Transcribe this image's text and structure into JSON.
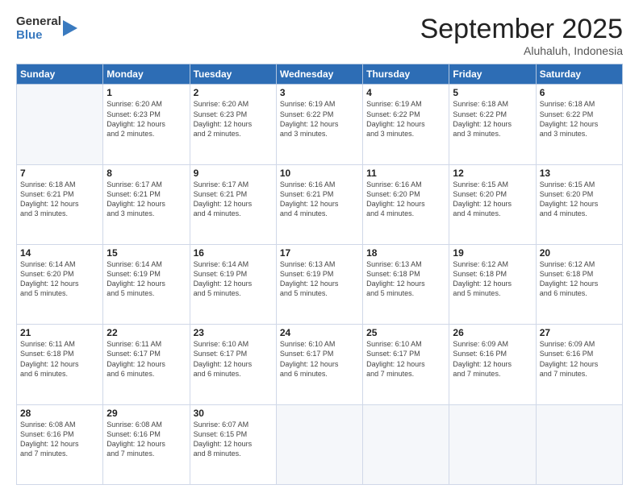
{
  "logo": {
    "general": "General",
    "blue": "Blue"
  },
  "header": {
    "month": "September 2025",
    "location": "Aluhaluh, Indonesia"
  },
  "weekdays": [
    "Sunday",
    "Monday",
    "Tuesday",
    "Wednesday",
    "Thursday",
    "Friday",
    "Saturday"
  ],
  "weeks": [
    [
      {
        "day": "",
        "info": ""
      },
      {
        "day": "1",
        "info": "Sunrise: 6:20 AM\nSunset: 6:23 PM\nDaylight: 12 hours\nand 2 minutes."
      },
      {
        "day": "2",
        "info": "Sunrise: 6:20 AM\nSunset: 6:23 PM\nDaylight: 12 hours\nand 2 minutes."
      },
      {
        "day": "3",
        "info": "Sunrise: 6:19 AM\nSunset: 6:22 PM\nDaylight: 12 hours\nand 3 minutes."
      },
      {
        "day": "4",
        "info": "Sunrise: 6:19 AM\nSunset: 6:22 PM\nDaylight: 12 hours\nand 3 minutes."
      },
      {
        "day": "5",
        "info": "Sunrise: 6:18 AM\nSunset: 6:22 PM\nDaylight: 12 hours\nand 3 minutes."
      },
      {
        "day": "6",
        "info": "Sunrise: 6:18 AM\nSunset: 6:22 PM\nDaylight: 12 hours\nand 3 minutes."
      }
    ],
    [
      {
        "day": "7",
        "info": "Sunrise: 6:18 AM\nSunset: 6:21 PM\nDaylight: 12 hours\nand 3 minutes."
      },
      {
        "day": "8",
        "info": "Sunrise: 6:17 AM\nSunset: 6:21 PM\nDaylight: 12 hours\nand 3 minutes."
      },
      {
        "day": "9",
        "info": "Sunrise: 6:17 AM\nSunset: 6:21 PM\nDaylight: 12 hours\nand 4 minutes."
      },
      {
        "day": "10",
        "info": "Sunrise: 6:16 AM\nSunset: 6:21 PM\nDaylight: 12 hours\nand 4 minutes."
      },
      {
        "day": "11",
        "info": "Sunrise: 6:16 AM\nSunset: 6:20 PM\nDaylight: 12 hours\nand 4 minutes."
      },
      {
        "day": "12",
        "info": "Sunrise: 6:15 AM\nSunset: 6:20 PM\nDaylight: 12 hours\nand 4 minutes."
      },
      {
        "day": "13",
        "info": "Sunrise: 6:15 AM\nSunset: 6:20 PM\nDaylight: 12 hours\nand 4 minutes."
      }
    ],
    [
      {
        "day": "14",
        "info": "Sunrise: 6:14 AM\nSunset: 6:20 PM\nDaylight: 12 hours\nand 5 minutes."
      },
      {
        "day": "15",
        "info": "Sunrise: 6:14 AM\nSunset: 6:19 PM\nDaylight: 12 hours\nand 5 minutes."
      },
      {
        "day": "16",
        "info": "Sunrise: 6:14 AM\nSunset: 6:19 PM\nDaylight: 12 hours\nand 5 minutes."
      },
      {
        "day": "17",
        "info": "Sunrise: 6:13 AM\nSunset: 6:19 PM\nDaylight: 12 hours\nand 5 minutes."
      },
      {
        "day": "18",
        "info": "Sunrise: 6:13 AM\nSunset: 6:18 PM\nDaylight: 12 hours\nand 5 minutes."
      },
      {
        "day": "19",
        "info": "Sunrise: 6:12 AM\nSunset: 6:18 PM\nDaylight: 12 hours\nand 5 minutes."
      },
      {
        "day": "20",
        "info": "Sunrise: 6:12 AM\nSunset: 6:18 PM\nDaylight: 12 hours\nand 6 minutes."
      }
    ],
    [
      {
        "day": "21",
        "info": "Sunrise: 6:11 AM\nSunset: 6:18 PM\nDaylight: 12 hours\nand 6 minutes."
      },
      {
        "day": "22",
        "info": "Sunrise: 6:11 AM\nSunset: 6:17 PM\nDaylight: 12 hours\nand 6 minutes."
      },
      {
        "day": "23",
        "info": "Sunrise: 6:10 AM\nSunset: 6:17 PM\nDaylight: 12 hours\nand 6 minutes."
      },
      {
        "day": "24",
        "info": "Sunrise: 6:10 AM\nSunset: 6:17 PM\nDaylight: 12 hours\nand 6 minutes."
      },
      {
        "day": "25",
        "info": "Sunrise: 6:10 AM\nSunset: 6:17 PM\nDaylight: 12 hours\nand 7 minutes."
      },
      {
        "day": "26",
        "info": "Sunrise: 6:09 AM\nSunset: 6:16 PM\nDaylight: 12 hours\nand 7 minutes."
      },
      {
        "day": "27",
        "info": "Sunrise: 6:09 AM\nSunset: 6:16 PM\nDaylight: 12 hours\nand 7 minutes."
      }
    ],
    [
      {
        "day": "28",
        "info": "Sunrise: 6:08 AM\nSunset: 6:16 PM\nDaylight: 12 hours\nand 7 minutes."
      },
      {
        "day": "29",
        "info": "Sunrise: 6:08 AM\nSunset: 6:16 PM\nDaylight: 12 hours\nand 7 minutes."
      },
      {
        "day": "30",
        "info": "Sunrise: 6:07 AM\nSunset: 6:15 PM\nDaylight: 12 hours\nand 8 minutes."
      },
      {
        "day": "",
        "info": ""
      },
      {
        "day": "",
        "info": ""
      },
      {
        "day": "",
        "info": ""
      },
      {
        "day": "",
        "info": ""
      }
    ]
  ]
}
